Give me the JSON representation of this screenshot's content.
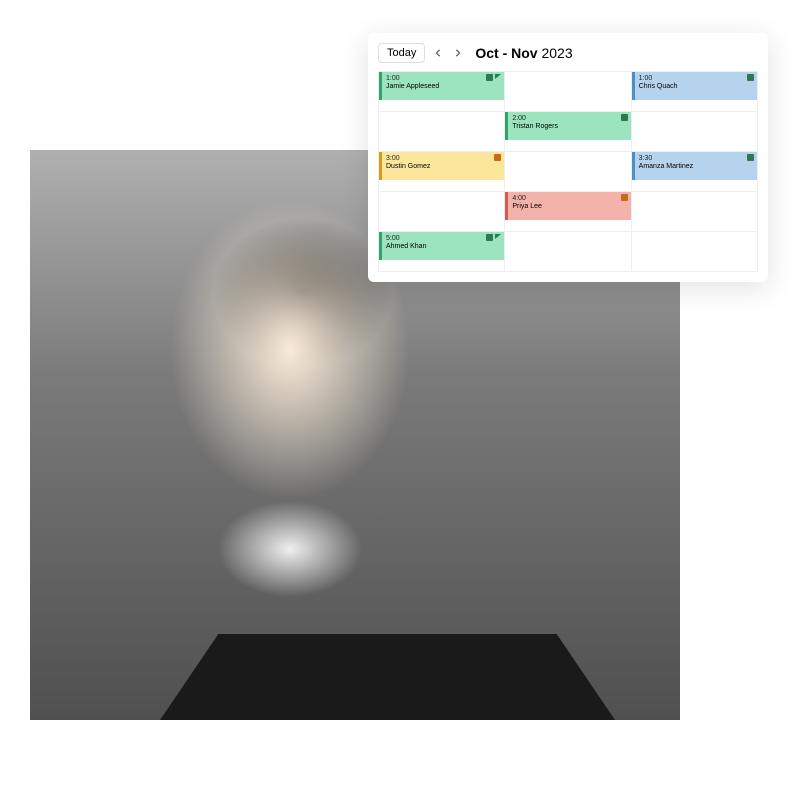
{
  "calendar": {
    "today_label": "Today",
    "date_range_bold": "Oct - Nov",
    "date_range_year": "2023",
    "colors": {
      "green": "#9be4bf",
      "yellow": "#fbe79b",
      "red": "#f3b3ab",
      "blue": "#b6d3ee"
    },
    "events": {
      "r0c0": {
        "time": "1:00",
        "name": "Jamie Appleseed",
        "color": "green",
        "icons": [
          "doc",
          "chat"
        ]
      },
      "r0c2": {
        "time": "1:00",
        "name": "Chris Quach",
        "color": "blue",
        "icons": [
          "doc"
        ]
      },
      "r1c1": {
        "time": "2:00",
        "name": "Tristan Rogers",
        "color": "green",
        "icons": [
          "doc"
        ]
      },
      "r2c0": {
        "time": "3:00",
        "name": "Dustin Gomez",
        "color": "yellow",
        "icons": [
          "doc-orange"
        ]
      },
      "r2c2": {
        "time": "3:30",
        "name": "Amanza Martinez",
        "color": "blue",
        "icons": [
          "doc"
        ]
      },
      "r3c1": {
        "time": "4:00",
        "name": "Priya Lee",
        "color": "red",
        "icons": [
          "doc-orange"
        ]
      },
      "r4c0": {
        "time": "5:00",
        "name": "Ahmed Khan",
        "color": "green",
        "icons": [
          "doc",
          "chat"
        ]
      }
    }
  }
}
